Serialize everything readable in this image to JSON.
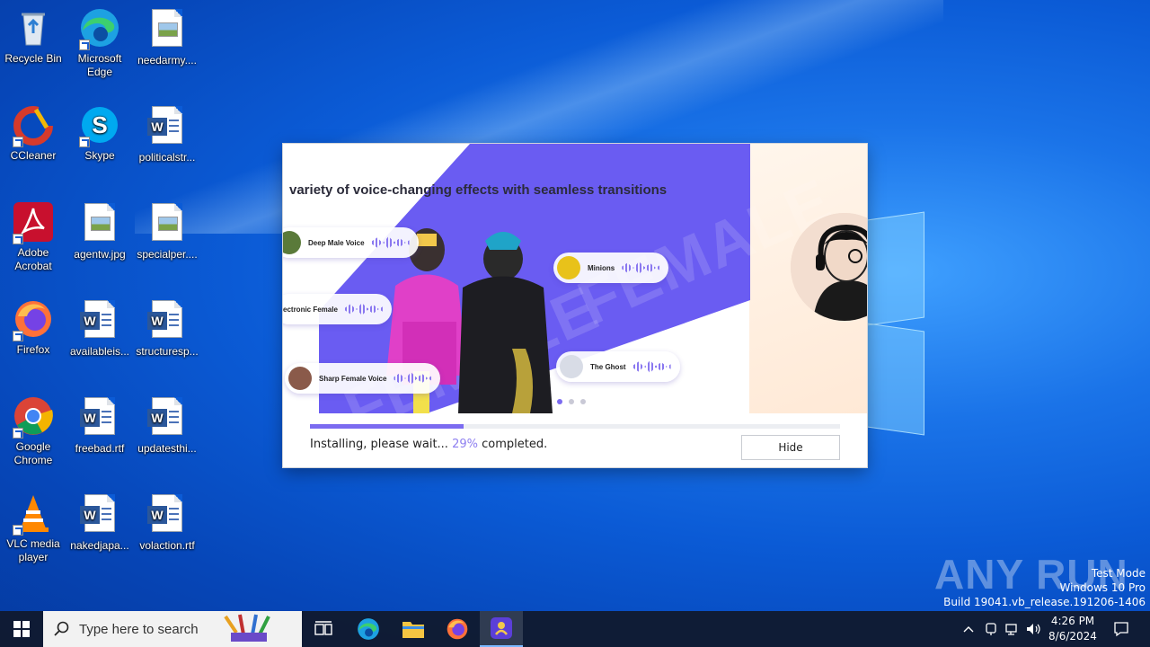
{
  "desktop": {
    "icons": [
      {
        "label": "Recycle Bin"
      },
      {
        "label": "Microsoft Edge"
      },
      {
        "label": "needarmy...."
      },
      {
        "label": "CCleaner"
      },
      {
        "label": "Skype"
      },
      {
        "label": "politicalstr..."
      },
      {
        "label": "Adobe Acrobat"
      },
      {
        "label": "agentw.jpg"
      },
      {
        "label": "specialper...."
      },
      {
        "label": "Firefox"
      },
      {
        "label": "availableis..."
      },
      {
        "label": "structuresp..."
      },
      {
        "label": "Google Chrome"
      },
      {
        "label": "freebad.rtf"
      },
      {
        "label": "updatesthi..."
      },
      {
        "label": "VLC media player"
      },
      {
        "label": "nakedjapa..."
      },
      {
        "label": "volaction.rtf"
      }
    ]
  },
  "installer": {
    "headline": "variety of voice-changing effects with seamless transitions",
    "watermark_text": "FEMALE",
    "voices": [
      {
        "label": "Deep Male Voice"
      },
      {
        "label": "ectronic Female"
      },
      {
        "label": "Sharp Female Voice"
      },
      {
        "label": "Minions"
      },
      {
        "label": "The Ghost"
      }
    ],
    "carousel": {
      "slides": 3,
      "active": 1
    },
    "progress_percent": 29,
    "status_prefix": "Installing, please wait... ",
    "status_percent": "29%",
    "status_suffix": " completed.",
    "hide_label": "Hide",
    "accent_color": "#7b6bf0"
  },
  "watermark": {
    "logo": "ANY RUN",
    "line1": "Test Mode",
    "line2": "Windows 10 Pro",
    "line3": "Build 19041.vb_release.191206-1406"
  },
  "taskbar": {
    "search_placeholder": "Type here to search",
    "pinned": [
      "task-view-icon",
      "edge-icon",
      "file-explorer-icon",
      "firefox-icon",
      "voice-changer-app-icon"
    ],
    "time": "4:26 PM",
    "date": "8/6/2024"
  }
}
